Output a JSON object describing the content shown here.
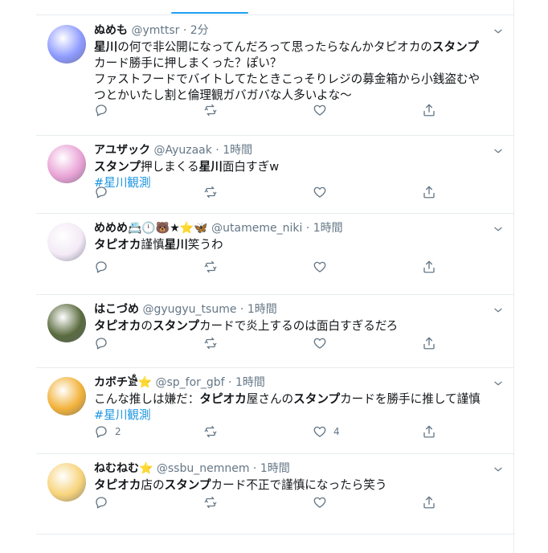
{
  "tweets": [
    {
      "name": "ぬめも",
      "handle": "@ymttsr",
      "dot": "·",
      "time": "2分",
      "text_parts": [
        {
          "t": "星川",
          "b": true
        },
        {
          "t": "の何で非公開になってんだろって思ったらなんかタピオカの",
          "b": false
        },
        {
          "t": "スタンプ",
          "b": true
        },
        {
          "t": "\nカード勝手に押しまくった？ぽい？\nファストフードでバイトしてたときこっそりレジの募金箱から小銭盗むや\nつとかいたし割と倫理観ガバガバな人多いよな〜",
          "b": false
        }
      ],
      "hashtag": "",
      "reply_count": "",
      "like_count": "",
      "avatar_color": "#8e9bff"
    },
    {
      "name": "アユザック",
      "handle": "@Ayuzaak",
      "dot": "·",
      "time": "1時間",
      "text_parts": [
        {
          "t": "スタンプ",
          "b": true
        },
        {
          "t": "押しまくる",
          "b": false
        },
        {
          "t": "星川",
          "b": true
        },
        {
          "t": "面白すぎw",
          "b": false
        }
      ],
      "hashtag": "#星川観測",
      "reply_count": "",
      "like_count": "",
      "avatar_color": "#e9a3d6"
    },
    {
      "name": "めめめ📇🕛🐻★⭐🦋",
      "handle": "@utameme_niki",
      "dot": "·",
      "time": "1時間",
      "text_parts": [
        {
          "t": "タピオカ",
          "b": true
        },
        {
          "t": "謹慎",
          "b": false
        },
        {
          "t": "星川",
          "b": true
        },
        {
          "t": "笑うわ",
          "b": false
        }
      ],
      "hashtag": "",
      "reply_count": "",
      "like_count": "",
      "avatar_color": "#f3eaf6"
    },
    {
      "name": "はこづめ",
      "handle": "@gyugyu_tsume",
      "dot": "·",
      "time": "1時間",
      "text_parts": [
        {
          "t": "タピオカ",
          "b": true
        },
        {
          "t": "の",
          "b": false
        },
        {
          "t": "スタンプ",
          "b": true
        },
        {
          "t": "カードで炎上するのは面白すぎるだろ",
          "b": false
        }
      ],
      "hashtag": "",
      "reply_count": "",
      "like_count": "",
      "avatar_color": "#5a6b3e"
    },
    {
      "name": "カボチ𓀀⭐",
      "handle": "@sp_for_gbf",
      "dot": "·",
      "time": "1時間",
      "text_parts": [
        {
          "t": "こんな推しは嫌だ：",
          "b": false
        },
        {
          "t": "タピオカ",
          "b": true
        },
        {
          "t": "屋さんの",
          "b": false
        },
        {
          "t": "スタンプ",
          "b": true
        },
        {
          "t": "カードを勝手に推して謹慎",
          "b": false
        }
      ],
      "hashtag": "#星川観測",
      "reply_count": "2",
      "like_count": "4",
      "avatar_color": "#f2b23a"
    },
    {
      "name": "ねむねむ⭐",
      "handle": "@ssbu_nemnem",
      "dot": "·",
      "time": "1時間",
      "text_parts": [
        {
          "t": "タピオカ",
          "b": true
        },
        {
          "t": "店の",
          "b": false
        },
        {
          "t": "スタンプ",
          "b": true
        },
        {
          "t": "カード不正で謹慎になったら笑う",
          "b": false
        }
      ],
      "hashtag": "",
      "reply_count": "",
      "like_count": "",
      "avatar_color": "#f7d37a"
    }
  ]
}
